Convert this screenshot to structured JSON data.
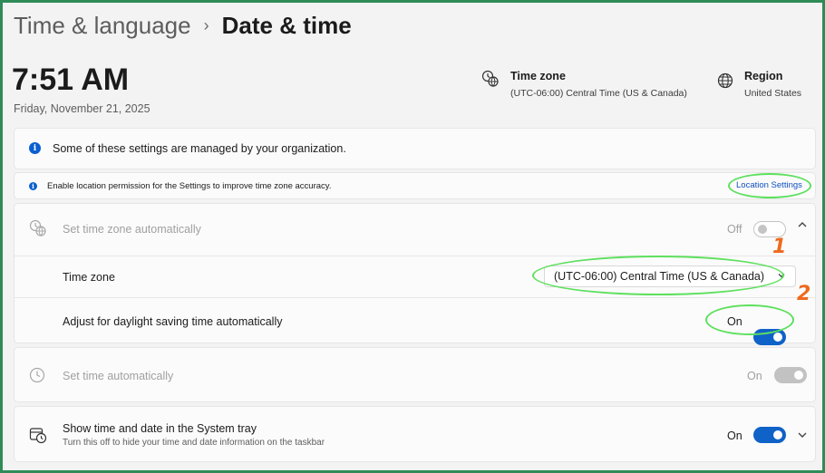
{
  "header": {
    "parent": "Time & language",
    "separator": "›",
    "current": "Date & time"
  },
  "clock": {
    "time": "7:51 AM",
    "date": "Friday, November 21, 2025"
  },
  "timezone_info": {
    "title": "Time zone",
    "value": "(UTC-06:00) Central Time (US & Canada)",
    "icon": "timezone-globe-icon"
  },
  "region_info": {
    "title": "Region",
    "value": "United States",
    "icon": "globe-icon"
  },
  "org_notice": {
    "text": "Some of these settings are managed by your organization."
  },
  "location_notice": {
    "text": "Enable location permission for the Settings to improve time zone accuracy.",
    "link": "Location Settings"
  },
  "set_tz_auto": {
    "label": "Set time zone automatically",
    "state": "Off",
    "enabled": false
  },
  "time_zone_row": {
    "label": "Time zone",
    "value": "(UTC-06:00) Central Time (US & Canada)"
  },
  "daylight_row": {
    "label": "Adjust for daylight saving time automatically",
    "state": "On"
  },
  "set_time_auto": {
    "label": "Set time automatically",
    "state": "On",
    "enabled": false
  },
  "system_tray": {
    "label": "Show time and date in the System tray",
    "sublabel": "Turn this off to hide your time and date information on the taskbar",
    "state": "On"
  },
  "annotations": {
    "one": "1",
    "two": "2",
    "highlight_color": "#5ee05e",
    "number_color": "#ee6a1e"
  },
  "colors": {
    "accent": "#0f62c7",
    "frame": "#2e8b57"
  }
}
